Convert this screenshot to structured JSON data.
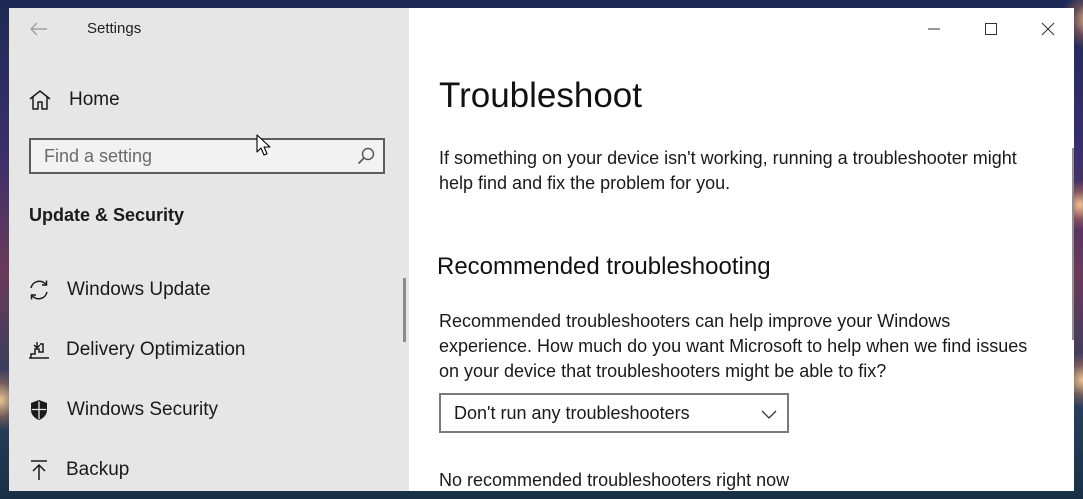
{
  "window": {
    "app_title": "Settings"
  },
  "sidebar": {
    "home_label": "Home",
    "search": {
      "placeholder": "Find a setting",
      "value": ""
    },
    "section_title": "Update & Security",
    "items": [
      {
        "label": "Windows Update",
        "icon": "sync-icon"
      },
      {
        "label": "Delivery Optimization",
        "icon": "delivery-optimization-icon"
      },
      {
        "label": "Windows Security",
        "icon": "shield-icon"
      },
      {
        "label": "Backup",
        "icon": "backup-arrow-icon"
      }
    ]
  },
  "main": {
    "title": "Troubleshoot",
    "intro": "If something on your device isn't working, running a troubleshooter might help find and fix the problem for you.",
    "recommended": {
      "heading": "Recommended troubleshooting",
      "description": "Recommended troubleshooters can help improve your Windows experience. How much do you want Microsoft to help when we find issues on your device that troubleshooters might be able to fix?",
      "dropdown_value": "Don't run any troubleshooters",
      "status": "No recommended troubleshooters right now"
    }
  },
  "colors": {
    "sidebar_bg": "#e6e6e6",
    "content_bg": "#ffffff",
    "text": "#1a1a1a",
    "muted": "#9a9a9a",
    "border": "#5c5c5c"
  }
}
